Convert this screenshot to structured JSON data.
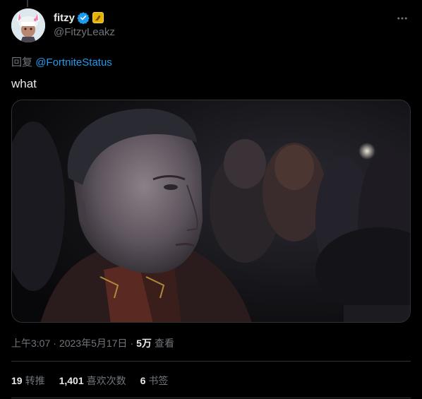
{
  "tweet": {
    "display_name": "fitzy",
    "handle": "@FitzyLeakz",
    "reply_prefix": "回复",
    "reply_mention": "@FortniteStatus",
    "text": "what",
    "time": "上午3:07",
    "separator": "·",
    "date": "2023年5月17日",
    "views_count": "5万",
    "views_label": "查看"
  },
  "stats": {
    "retweets_count": "19",
    "retweets_label": "转推",
    "likes_count": "1,401",
    "likes_label": "喜欢次数",
    "bookmarks_count": "6",
    "bookmarks_label": "书签"
  },
  "icons": {
    "verified": "verified-badge-icon",
    "affiliate": "affiliate-badge-icon",
    "more": "more-options-icon"
  },
  "colors": {
    "background": "#000000",
    "text_primary": "#e7e9ea",
    "text_secondary": "#71767b",
    "link": "#1d9bf0",
    "verified": "#1d9bf0",
    "affiliate": "#e6b400",
    "divider": "#2f3336"
  }
}
